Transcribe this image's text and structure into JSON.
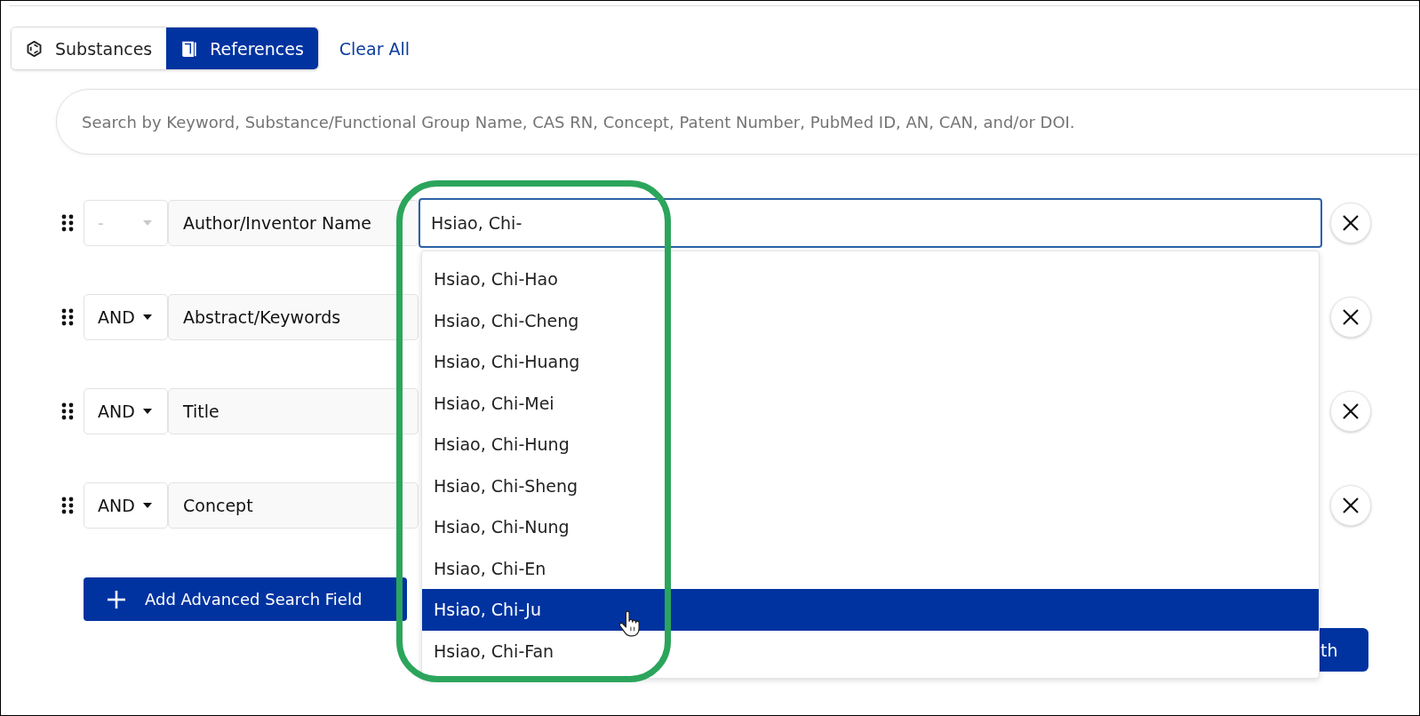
{
  "mode_tabs": [
    {
      "label": "Substances",
      "selected": false
    },
    {
      "label": "References",
      "selected": true
    }
  ],
  "clear_all_link": "Clear All",
  "search": {
    "placeholder": "Search by Keyword, Substance/Functional Group Name, CAS RN, Concept, Patent Number, PubMed ID, AN, CAN, and/or DOI."
  },
  "advanced_fields": [
    {
      "operator": "-",
      "operator_disabled": true,
      "field": "Author/Inventor Name",
      "value": "Hsiao, Chi-",
      "focused": true,
      "suggestions": [
        {
          "label": "Hsiao, Chi-Hao",
          "selected": false
        },
        {
          "label": "Hsiao, Chi-Cheng",
          "selected": false
        },
        {
          "label": "Hsiao, Chi-Huang",
          "selected": false
        },
        {
          "label": "Hsiao, Chi-Mei",
          "selected": false
        },
        {
          "label": "Hsiao, Chi-Hung",
          "selected": false
        },
        {
          "label": "Hsiao, Chi-Sheng",
          "selected": false
        },
        {
          "label": "Hsiao, Chi-Nung",
          "selected": false
        },
        {
          "label": "Hsiao, Chi-En",
          "selected": false
        },
        {
          "label": "Hsiao, Chi-Ju",
          "selected": true
        },
        {
          "label": "Hsiao, Chi-Fan",
          "selected": false
        }
      ]
    },
    {
      "operator": "AND",
      "operator_disabled": false,
      "field": "Abstract/Keywords"
    },
    {
      "operator": "AND",
      "operator_disabled": false,
      "field": "Title"
    },
    {
      "operator": "AND",
      "operator_disabled": false,
      "field": "Concept"
    }
  ],
  "add_field_button": "Add Advanced Search Field",
  "search_button": "th"
}
